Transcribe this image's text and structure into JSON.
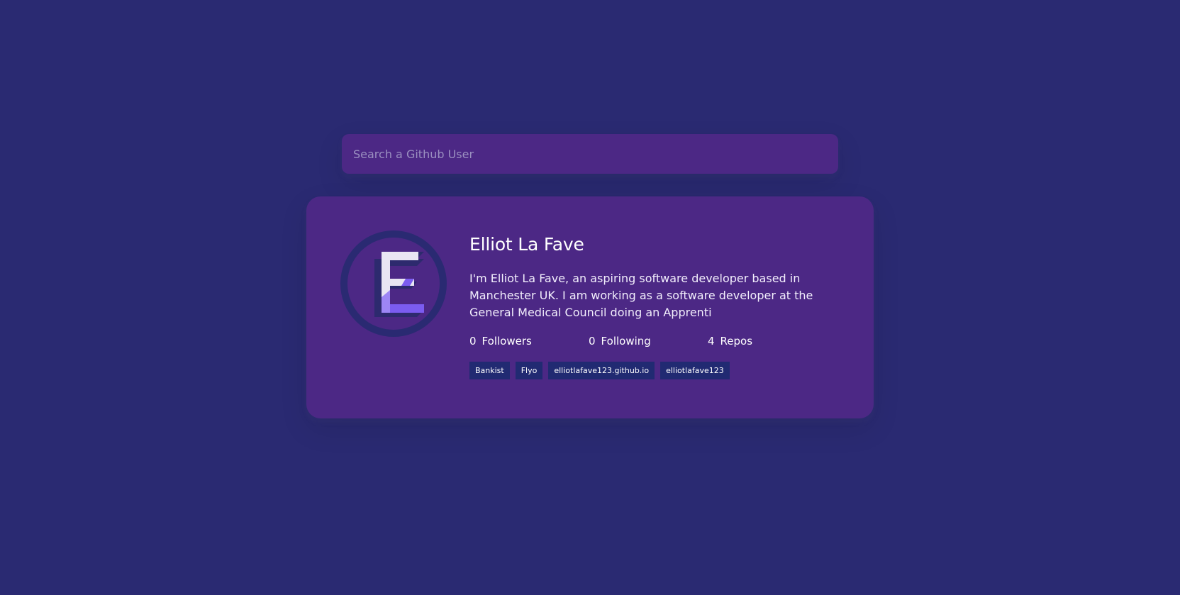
{
  "search": {
    "placeholder": "Search a Github User"
  },
  "profile": {
    "avatar_icon": "letter-e-logo-icon",
    "name": "Elliot La Fave",
    "bio": "I'm Elliot La Fave, an aspiring software developer based in Manchester UK. I am working as a software developer at the General Medical Council doing an Apprenti",
    "stats": [
      {
        "count": "0",
        "label": "Followers"
      },
      {
        "count": "0",
        "label": "Following"
      },
      {
        "count": "4",
        "label": "Repos"
      }
    ],
    "repos": [
      "Bankist",
      "Flyo",
      "elliotlafave123.github.io",
      "elliotlafave123"
    ]
  },
  "colors": {
    "background": "#2a2a72",
    "card": "#4c2885",
    "repo_tag": "#212a72",
    "accent": "#7b5cf0"
  }
}
